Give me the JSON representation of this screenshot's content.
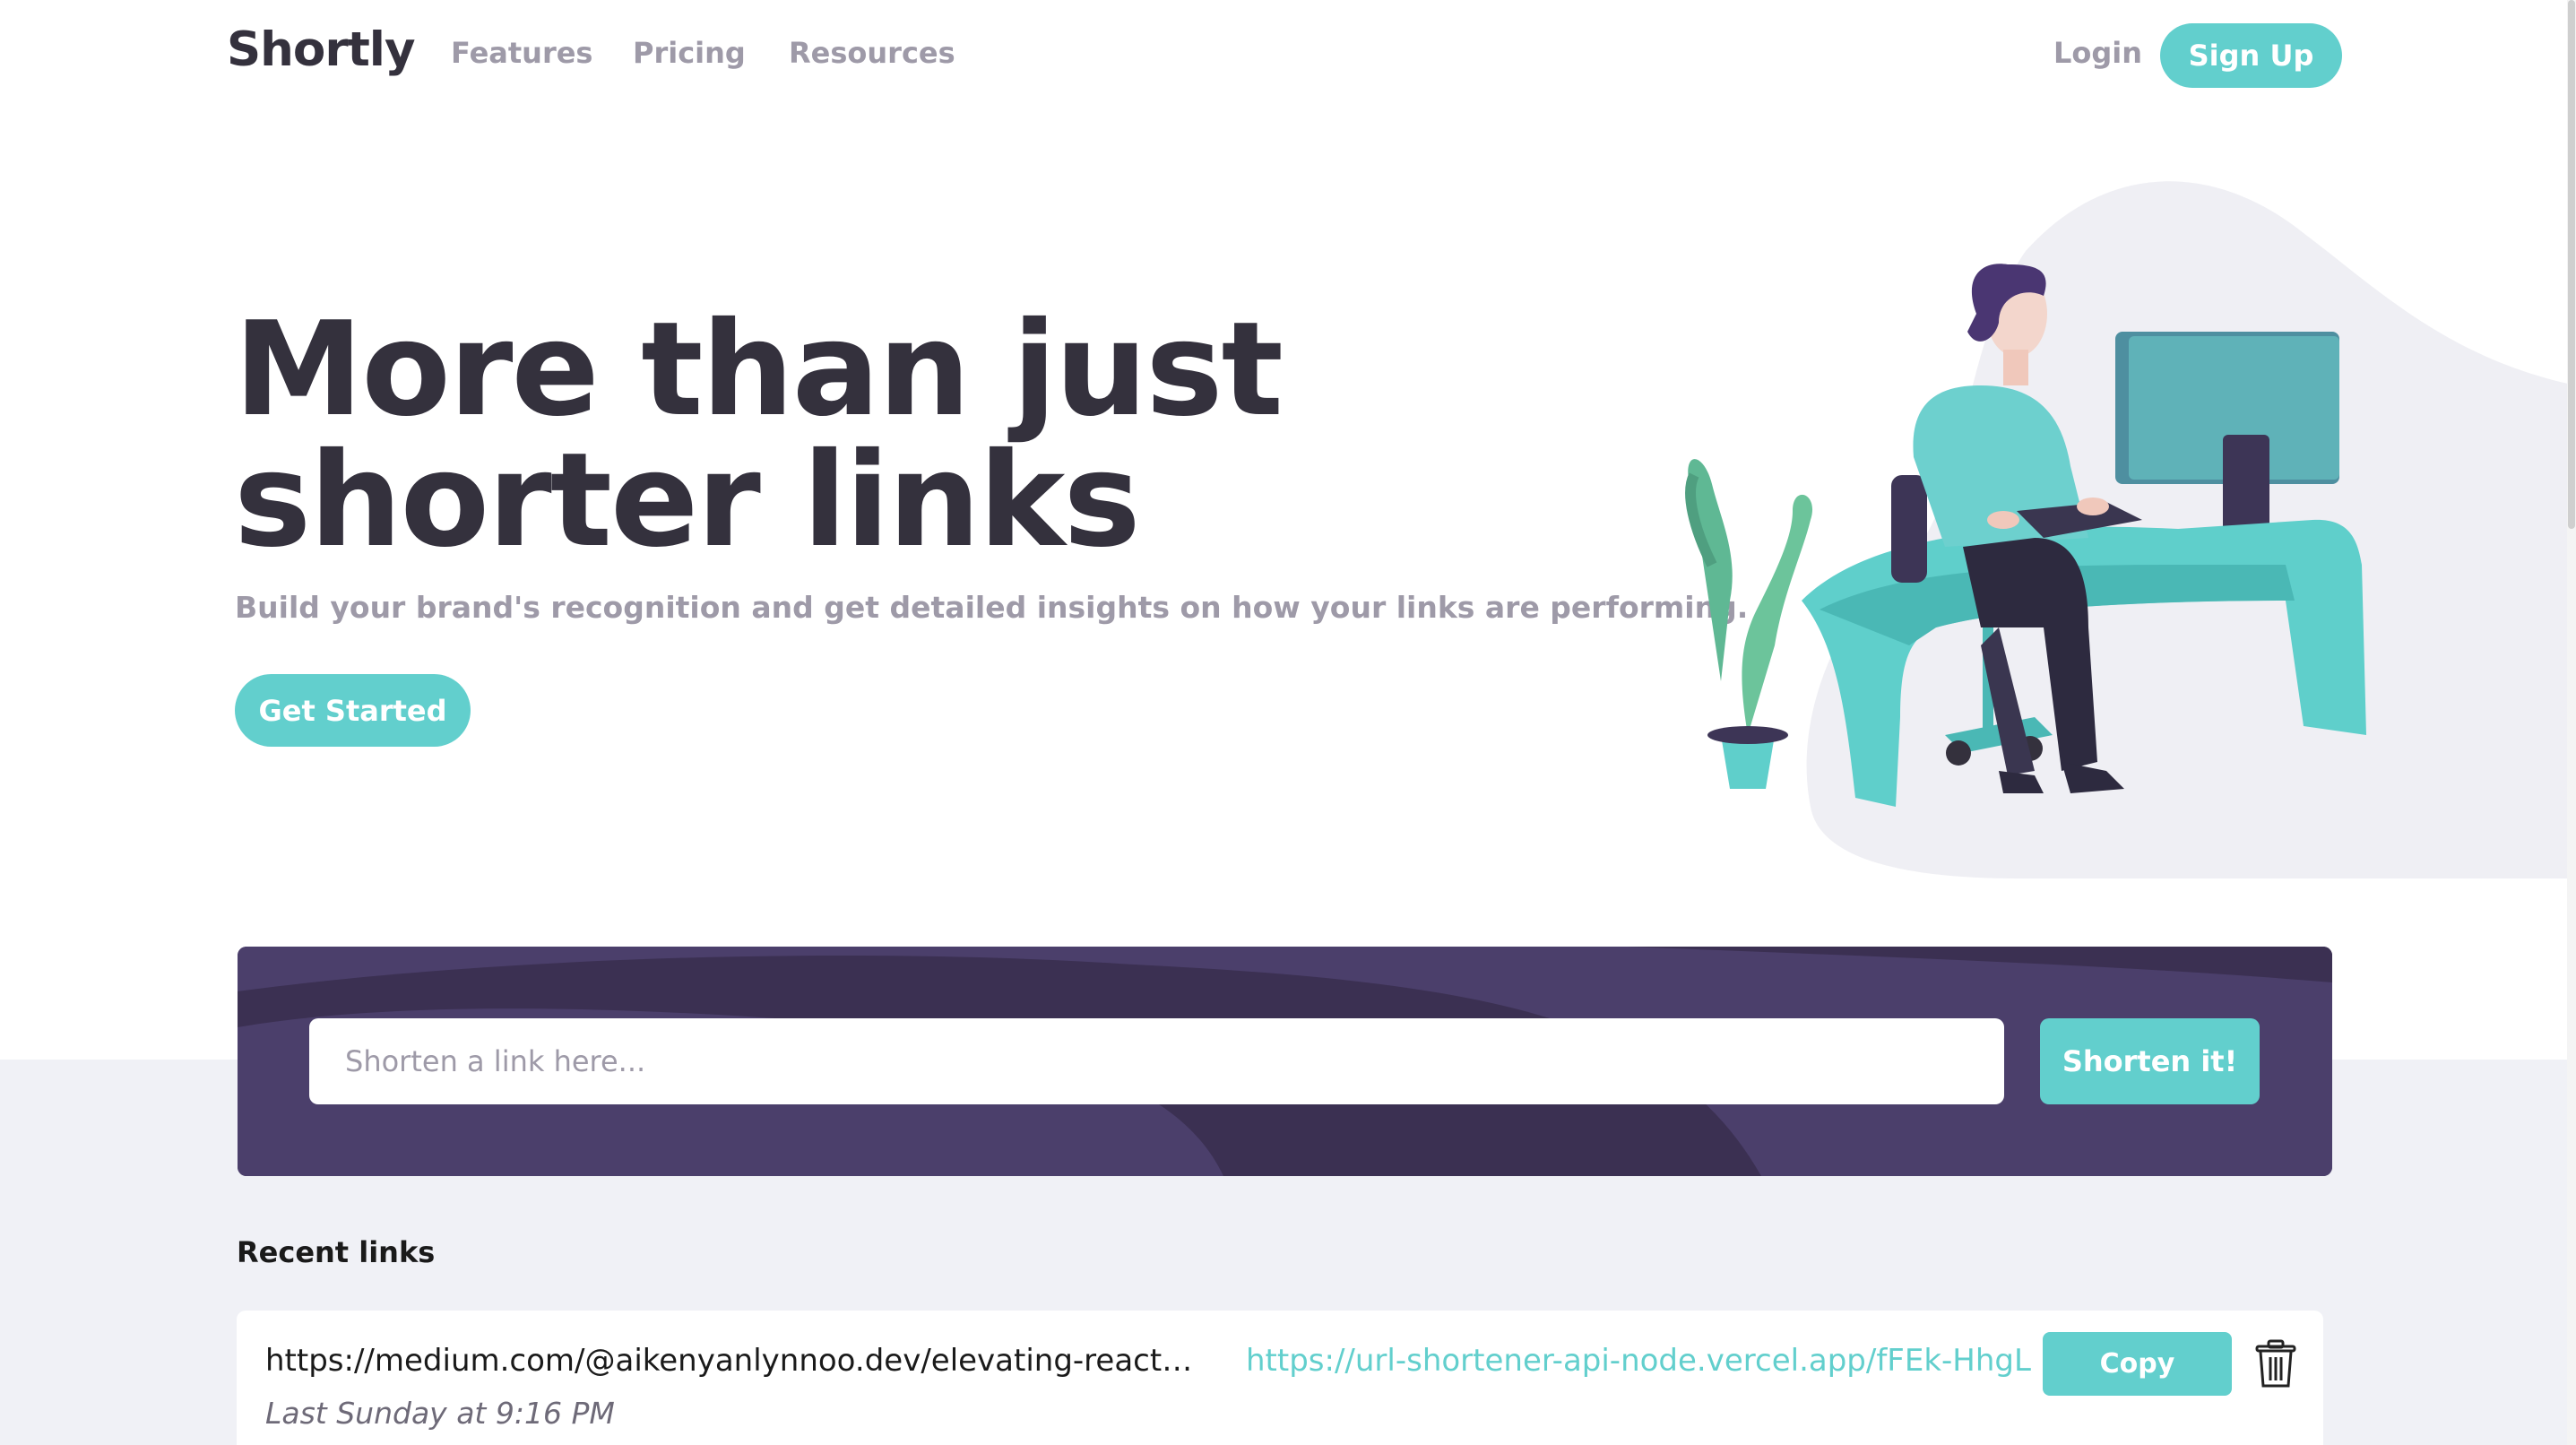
{
  "header": {
    "logo": "Shortly",
    "nav": [
      "Features",
      "Pricing",
      "Resources"
    ],
    "login": "Login",
    "signup": "Sign Up"
  },
  "hero": {
    "title": "More than just shorter links",
    "subtitle": "Build your brand's recognition and get detailed insights on how your links are performing.",
    "cta": "Get Started"
  },
  "shortener": {
    "placeholder": "Shorten a link here...",
    "button": "Shorten it!"
  },
  "recent": {
    "title": "Recent links",
    "links": [
      {
        "original": "https://medium.com/@aikenyanlynnoo.dev/elevating-react-...",
        "short": "https://url-shortener-api-node.vercel.app/fFEk-HhgL",
        "date": "Last Sunday at 9:16 PM",
        "copy_label": "Copy"
      }
    ]
  },
  "colors": {
    "primary": "#62cfcd",
    "dark": "#34313d",
    "purple": "#4b3f6b",
    "gray": "#9e9aa8",
    "bg_light": "#f0f1f6"
  }
}
